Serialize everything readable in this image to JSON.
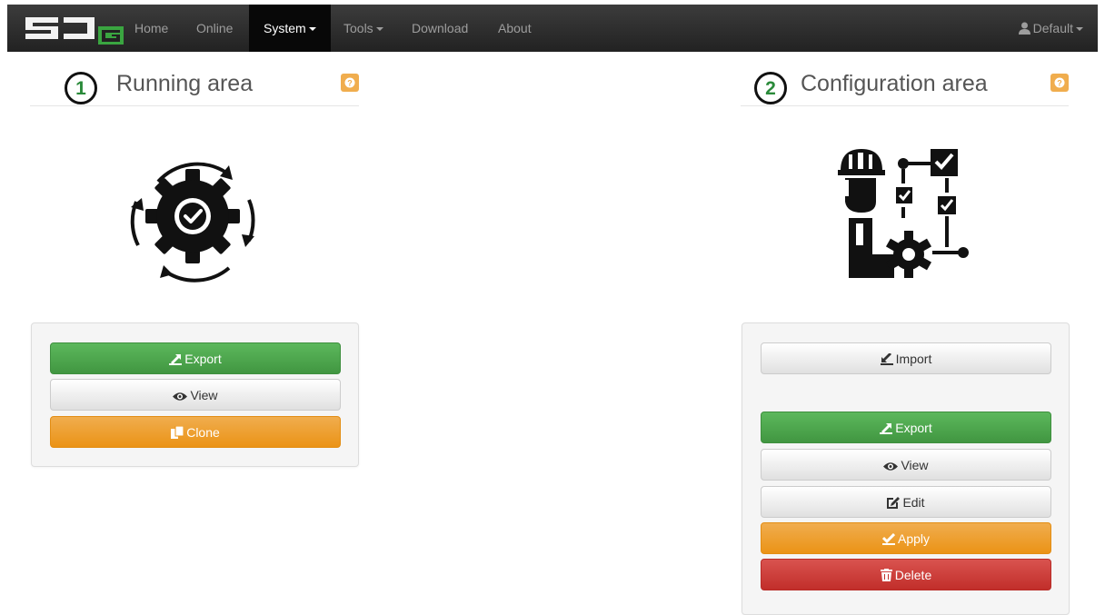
{
  "brand": {
    "logo_text": "SDG"
  },
  "nav": {
    "home": "Home",
    "online": "Online",
    "system": "System",
    "tools": "Tools",
    "download": "Download",
    "about": "About",
    "user": "Default"
  },
  "running": {
    "number": "1",
    "title": "Running area",
    "buttons": {
      "export": "Export",
      "view": "View",
      "clone": "Clone"
    }
  },
  "configuration": {
    "number": "2",
    "title": "Configuration area",
    "buttons": {
      "import": "Import",
      "export": "Export",
      "view": "View",
      "edit": "Edit",
      "apply": "Apply",
      "delete": "Delete"
    }
  },
  "colors": {
    "navbar": "#222222",
    "success": "#5cb85c",
    "warning": "#f0ad4e",
    "danger": "#d9534f",
    "number_green": "#2a8a3a"
  },
  "icons": [
    "sdg-logo",
    "user-icon",
    "help-icon",
    "gear-cycle-icon",
    "engineer-workflow-icon",
    "export-icon",
    "eye-icon",
    "clone-icon",
    "import-icon",
    "edit-icon",
    "apply-icon",
    "trash-icon"
  ]
}
